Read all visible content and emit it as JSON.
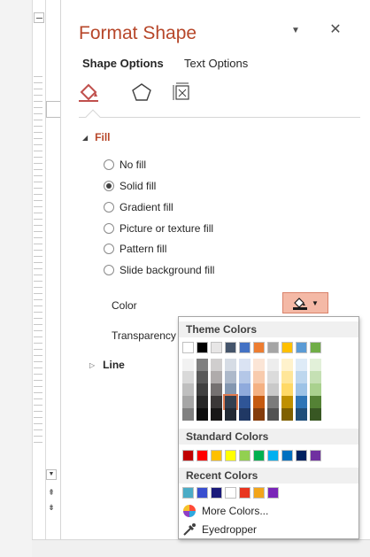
{
  "pane": {
    "title": "Format Shape",
    "tabs": {
      "shape_options": "Shape Options",
      "text_options": "Text Options"
    },
    "icons": {
      "menu": "dropdown-triangle-icon",
      "close": "close-icon"
    }
  },
  "fill": {
    "header": "Fill",
    "options": [
      {
        "label": "No fill",
        "checked": false
      },
      {
        "label": "Solid fill",
        "checked": true
      },
      {
        "label": "Gradient fill",
        "checked": false
      },
      {
        "label": "Picture or texture fill",
        "checked": false
      },
      {
        "label": "Pattern fill",
        "checked": false
      },
      {
        "label": "Slide background fill",
        "checked": false
      }
    ],
    "color_label": "Color",
    "transparency_label": "Transparency"
  },
  "line": {
    "header": "Line"
  },
  "popup": {
    "theme_header": "Theme Colors",
    "standard_header": "Standard Colors",
    "recent_header": "Recent Colors",
    "more_colors": "More Colors...",
    "eyedropper": "Eyedropper",
    "theme_colors": [
      "#ffffff",
      "#000000",
      "#e7e6e6",
      "#44546a",
      "#4472c4",
      "#ed7d31",
      "#a5a5a5",
      "#ffc000",
      "#5b9bd5",
      "#70ad47"
    ],
    "theme_shades": [
      [
        "#f2f2f2",
        "#d9d9d9",
        "#bfbfbf",
        "#a6a6a6",
        "#808080"
      ],
      [
        "#808080",
        "#595959",
        "#404040",
        "#262626",
        "#0d0d0d"
      ],
      [
        "#d0cece",
        "#afabab",
        "#757171",
        "#3b3838",
        "#181717"
      ],
      [
        "#d6dce5",
        "#adb9ca",
        "#8497b0",
        "#333f50",
        "#222a35"
      ],
      [
        "#dae3f3",
        "#b4c7e7",
        "#8faadc",
        "#2f5597",
        "#203864"
      ],
      [
        "#fbe5d6",
        "#f8cbad",
        "#f4b183",
        "#c55a11",
        "#843c0c"
      ],
      [
        "#ededed",
        "#dbdbdb",
        "#c9c9c9",
        "#7b7b7b",
        "#525252"
      ],
      [
        "#fff2cc",
        "#ffe699",
        "#ffd966",
        "#bf9000",
        "#7f6000"
      ],
      [
        "#deebf7",
        "#bdd7ee",
        "#9dc3e6",
        "#2e75b6",
        "#1f4e79"
      ],
      [
        "#e2f0d9",
        "#c5e0b4",
        "#a9d18e",
        "#548235",
        "#385723"
      ]
    ],
    "standard_colors": [
      "#c00000",
      "#ff0000",
      "#ffc000",
      "#ffff00",
      "#92d050",
      "#00b050",
      "#00b0f0",
      "#0070c0",
      "#002060",
      "#7030a0"
    ],
    "recent_colors": [
      "#4bacc6",
      "#3a4fcf",
      "#1a1a7a",
      "#ffffff",
      "#e8351f",
      "#f2a51a",
      "#7a25b8"
    ]
  }
}
